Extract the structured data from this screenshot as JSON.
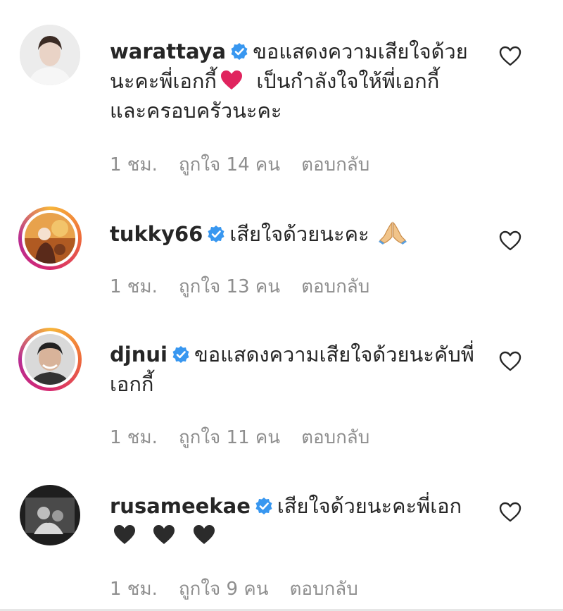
{
  "comments": [
    {
      "username": "warattaya",
      "verified": true,
      "text_before_emoji": "ขอแสดงความเสียใจด้วยนะคะพี่เอกกี้",
      "emoji": "red-heart",
      "text_after_emoji": "เป็นกำลังใจให้พี่เอกกี้และครอบครัวนะคะ",
      "time": "1 ชม.",
      "likes": "ถูกใจ 14 คน",
      "reply": "ตอบกลับ"
    },
    {
      "username": "tukky66",
      "verified": true,
      "text": "เสียใจด้วยนะคะ",
      "emoji": "folded-hands",
      "time": "1 ชม.",
      "likes": "ถูกใจ 13 คน",
      "reply": "ตอบกลับ"
    },
    {
      "username": "djnui",
      "verified": true,
      "text": "ขอแสดงความเสียใจด้วยนะคับพี่เอกกี้",
      "time": "1 ชม.",
      "likes": "ถูกใจ 11 คน",
      "reply": "ตอบกลับ"
    },
    {
      "username": "rusameekae",
      "verified": true,
      "text": "เสียใจด้วยนะคะพี่เอก",
      "emoji": "black-heart x3",
      "time": "1 ชม.",
      "likes": "ถูกใจ 9 คน",
      "reply": "ตอบกลับ"
    }
  ],
  "colors": {
    "text": "#262626",
    "meta": "#8e8e8e",
    "verified": "#3897f0",
    "red_heart": "#e0245e",
    "black_heart": "#2b2b2b"
  }
}
